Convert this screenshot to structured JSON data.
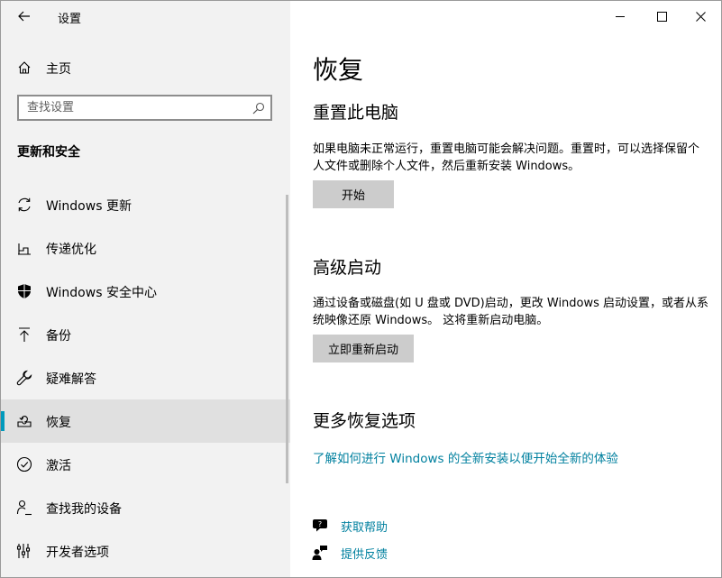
{
  "window": {
    "app_title": "设置"
  },
  "sidebar": {
    "home_label": "主页",
    "search_placeholder": "查找设置",
    "section_heading": "更新和安全",
    "items": [
      {
        "label": "Windows 更新",
        "icon": "sync-icon",
        "selected": false
      },
      {
        "label": "传递优化",
        "icon": "delivery-optimization-icon",
        "selected": false
      },
      {
        "label": "Windows 安全中心",
        "icon": "shield-icon",
        "selected": false
      },
      {
        "label": "备份",
        "icon": "backup-upload-icon",
        "selected": false
      },
      {
        "label": "疑难解答",
        "icon": "wrench-icon",
        "selected": false
      },
      {
        "label": "恢复",
        "icon": "recovery-icon",
        "selected": true
      },
      {
        "label": "激活",
        "icon": "check-circle-icon",
        "selected": false
      },
      {
        "label": "查找我的设备",
        "icon": "person-location-icon",
        "selected": false
      },
      {
        "label": "开发者选项",
        "icon": "developer-icon",
        "selected": false
      }
    ]
  },
  "main": {
    "title": "恢复",
    "reset": {
      "heading": "重置此电脑",
      "description": "如果电脑未正常运行，重置电脑可能会解决问题。重置时，可以选择保留个人文件或删除个人文件，然后重新安装 Windows。",
      "button": "开始"
    },
    "advanced": {
      "heading": "高级启动",
      "description": "通过设备或磁盘(如 U 盘或 DVD)启动，更改 Windows 启动设置，或者从系统映像还原 Windows。 这将重新启动电脑。",
      "button": "立即重新启动"
    },
    "more": {
      "heading": "更多恢复选项",
      "link": "了解如何进行 Windows 的全新安装以便开始全新的体验"
    },
    "help": {
      "get_help": "获取帮助",
      "feedback": "提供反馈"
    }
  },
  "colors": {
    "accent": "#0099bc",
    "link": "#00809f",
    "sidebar_bg": "#f2f2f2",
    "button_bg": "#cccccc"
  }
}
